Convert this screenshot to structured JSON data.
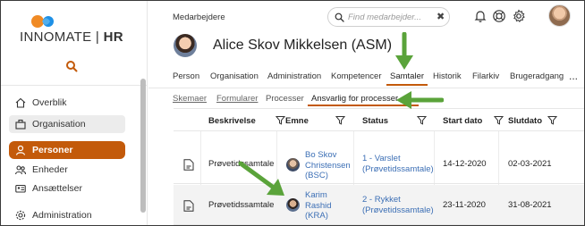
{
  "brand": {
    "name_light": "INNOMATE",
    "name_bold": "HR"
  },
  "header": {
    "section_title": "Medarbejdere",
    "search_placeholder": "Find medarbejder...",
    "icons": [
      "bell-icon",
      "help-icon",
      "gear-icon"
    ]
  },
  "sidebar": {
    "items": [
      {
        "label": "Overblik",
        "icon": "home-icon"
      },
      {
        "label": "Organisation",
        "icon": "org-icon"
      },
      {
        "label": "Personer",
        "icon": "person-icon"
      },
      {
        "label": "Enheder",
        "icon": "units-icon"
      },
      {
        "label": "Ansættelser",
        "icon": "id-card-icon"
      },
      {
        "label": "Administration",
        "icon": "admin-icon"
      }
    ]
  },
  "person": {
    "name": "Alice Skov Mikkelsen (ASM)"
  },
  "tabs": {
    "items": [
      "Person",
      "Organisation",
      "Administration",
      "Kompetencer",
      "Samtaler",
      "Historik",
      "Filarkiv",
      "Brugeradgang"
    ],
    "active": "Samtaler",
    "more": "..."
  },
  "subtabs": {
    "items": [
      "Skemaer",
      "Formularer",
      "Processer",
      "Ansvarlig for processer"
    ],
    "active": "Ansvarlig for processer"
  },
  "table": {
    "columns": [
      "Beskrivelse",
      "Emne",
      "Status",
      "Start dato",
      "Slutdato"
    ],
    "rows": [
      {
        "beskrivelse": "Prøvetidssamtale",
        "emne": [
          "Bo Skov",
          "Christensen",
          "(BSC)"
        ],
        "status": [
          "1 - Varslet",
          "(Prøvetidssamtale)"
        ],
        "start": "14-12-2020",
        "slut": "02-03-2021"
      },
      {
        "beskrivelse": "Prøvetidssamtale",
        "emne": [
          "Karim",
          "Rashid",
          "(KRA)"
        ],
        "status": [
          "2 - Rykket",
          "(Prøvetidssamtale)"
        ],
        "start": "23-11-2020",
        "slut": "31-08-2021"
      }
    ]
  },
  "colors": {
    "accent": "#c35a0a",
    "link": "#3c6fb5",
    "arrow": "#5aa33a"
  }
}
